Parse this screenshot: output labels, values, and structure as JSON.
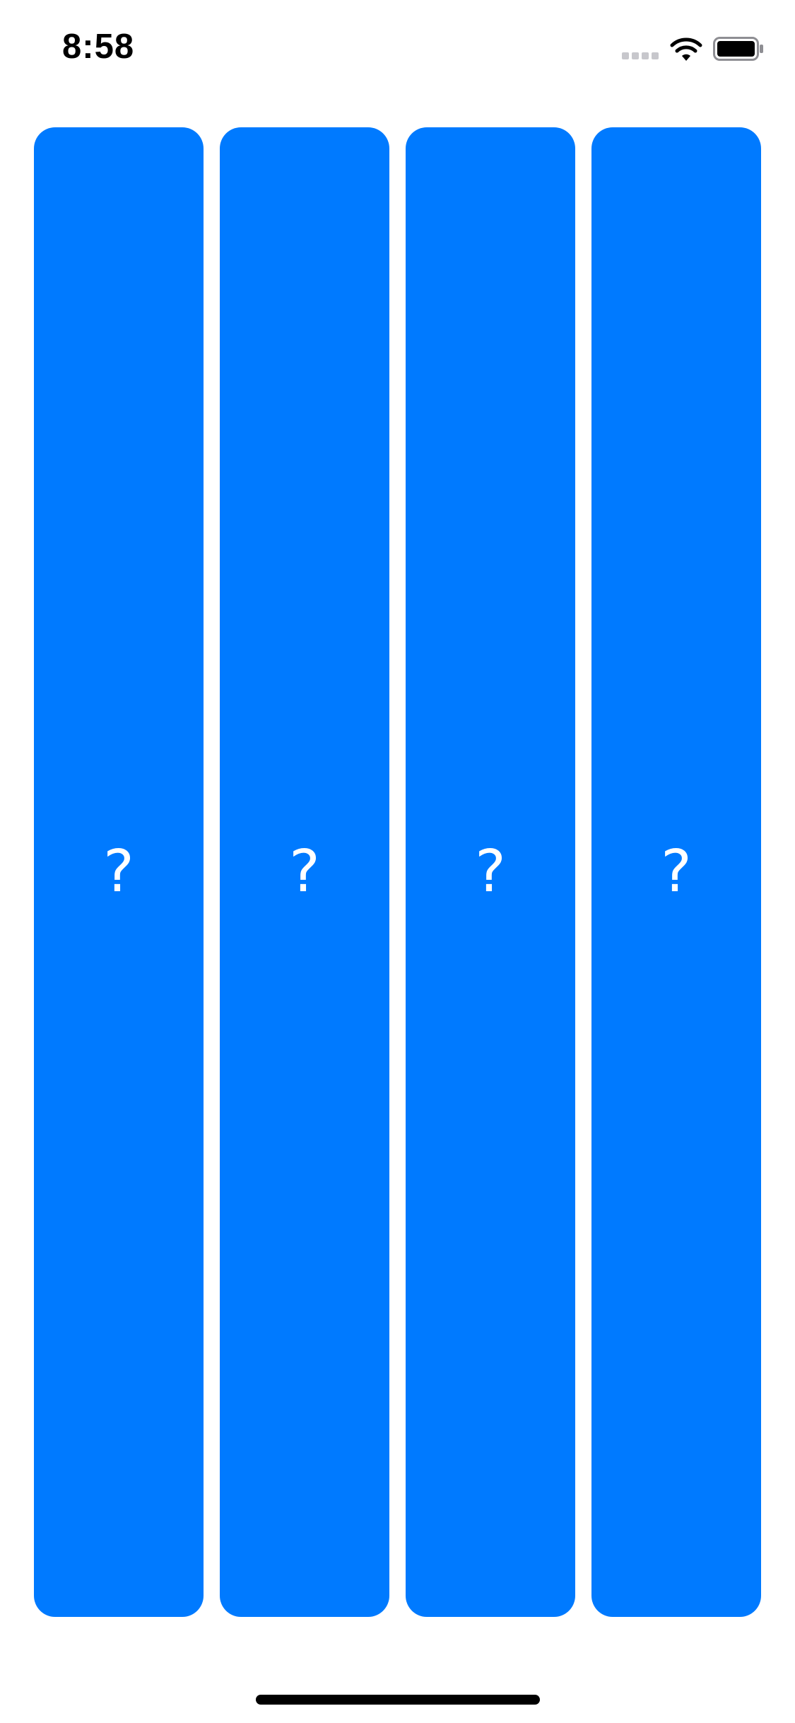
{
  "status_bar": {
    "time": "8:58",
    "signal_icon": "cellular-signal-icon",
    "wifi_icon": "wifi-icon",
    "battery_icon": "battery-icon"
  },
  "cards": [
    {
      "label": "?",
      "color": "#007aff"
    },
    {
      "label": "?",
      "color": "#007aff"
    },
    {
      "label": "?",
      "color": "#007aff"
    },
    {
      "label": "?",
      "color": "#007aff"
    }
  ],
  "colors": {
    "card": "#007aff",
    "background": "#ffffff",
    "text": "#ffffff"
  }
}
